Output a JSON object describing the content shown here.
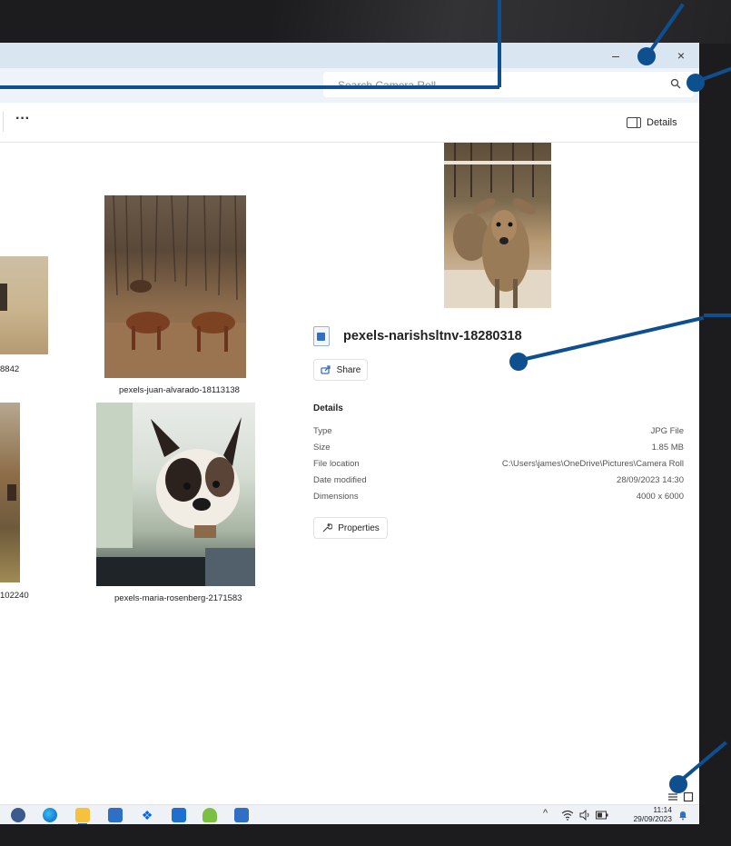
{
  "window": {
    "minimize_glyph": "–",
    "close_glyph": "×"
  },
  "search": {
    "placeholder": "Search Camera Roll"
  },
  "toolbar": {
    "more_label": "···",
    "details_label": "Details"
  },
  "files": [
    {
      "caption": "8842"
    },
    {
      "caption": "pexels-juan-alvarado-18113138"
    },
    {
      "caption": "102240"
    },
    {
      "caption": "pexels-maria-rosenberg-2171583"
    }
  ],
  "details": {
    "file_name": "pexels-narishsltnv-18280318",
    "share_label": "Share",
    "heading": "Details",
    "properties": [
      {
        "key": "Type",
        "value": "JPG File"
      },
      {
        "key": "Size",
        "value": "1.85 MB"
      },
      {
        "key": "File location",
        "value": "C:\\Users\\james\\OneDrive\\Pictures\\Camera Roll"
      },
      {
        "key": "Date modified",
        "value": "28/09/2023 14:30"
      },
      {
        "key": "Dimensions",
        "value": "4000 x 6000"
      }
    ],
    "properties_button": "Properties"
  },
  "taskbar": {
    "time": "11:14",
    "date": "29/09/2023"
  },
  "colors": {
    "callout": "#0e4f8f",
    "accent": "#2f6fc6"
  }
}
